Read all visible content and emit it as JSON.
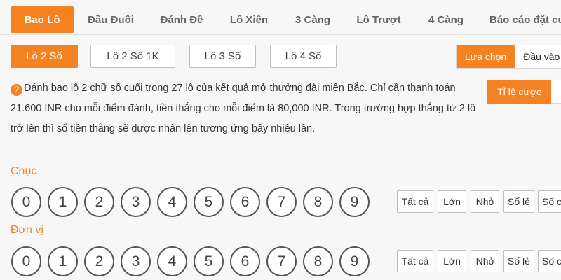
{
  "tabs": [
    {
      "label": "Bao Lô",
      "active": true
    },
    {
      "label": "Đầu Đuôi"
    },
    {
      "label": "Đánh Đề"
    },
    {
      "label": "Lô Xiên"
    },
    {
      "label": "3 Càng"
    },
    {
      "label": "Lô Trượt"
    },
    {
      "label": "4 Càng"
    },
    {
      "label": "Báo cáo đặt cư"
    }
  ],
  "subtabs": [
    {
      "label": "Lô 2 Số",
      "active": true
    },
    {
      "label": "Lô 2 Số 1K"
    },
    {
      "label": "Lô 3 Số"
    },
    {
      "label": "Lô 4 Số"
    }
  ],
  "mode": {
    "select_label": "Lựa chọn",
    "input_label": "Đầu vào"
  },
  "odds_label": "Tỉ lệ cược",
  "description": "Đánh bao lô 2 chữ số cuối trong 27 lô của kết quả mở thưởng đài miền Bắc. Chỉ cần thanh toán 21.600 INR cho mỗi điểm đánh, tiền thắng cho mỗi điểm là 80,000 INR. Trong trường hợp thắng từ 2 lô trở lên thì số tiền thắng sẽ được nhân lên tương ứng bấy nhiêu lần.",
  "help_icon": "?",
  "rows": [
    {
      "label": "Chục",
      "numbers": [
        "0",
        "1",
        "2",
        "3",
        "4",
        "5",
        "6",
        "7",
        "8",
        "9"
      ]
    },
    {
      "label": "Đơn vị",
      "numbers": [
        "0",
        "1",
        "2",
        "3",
        "4",
        "5",
        "6",
        "7",
        "8",
        "9"
      ]
    }
  ],
  "quick": [
    "Tất cả",
    "Lớn",
    "Nhỏ",
    "Số lẻ",
    "Số chẵn"
  ],
  "colors": {
    "accent": "#f58220"
  }
}
